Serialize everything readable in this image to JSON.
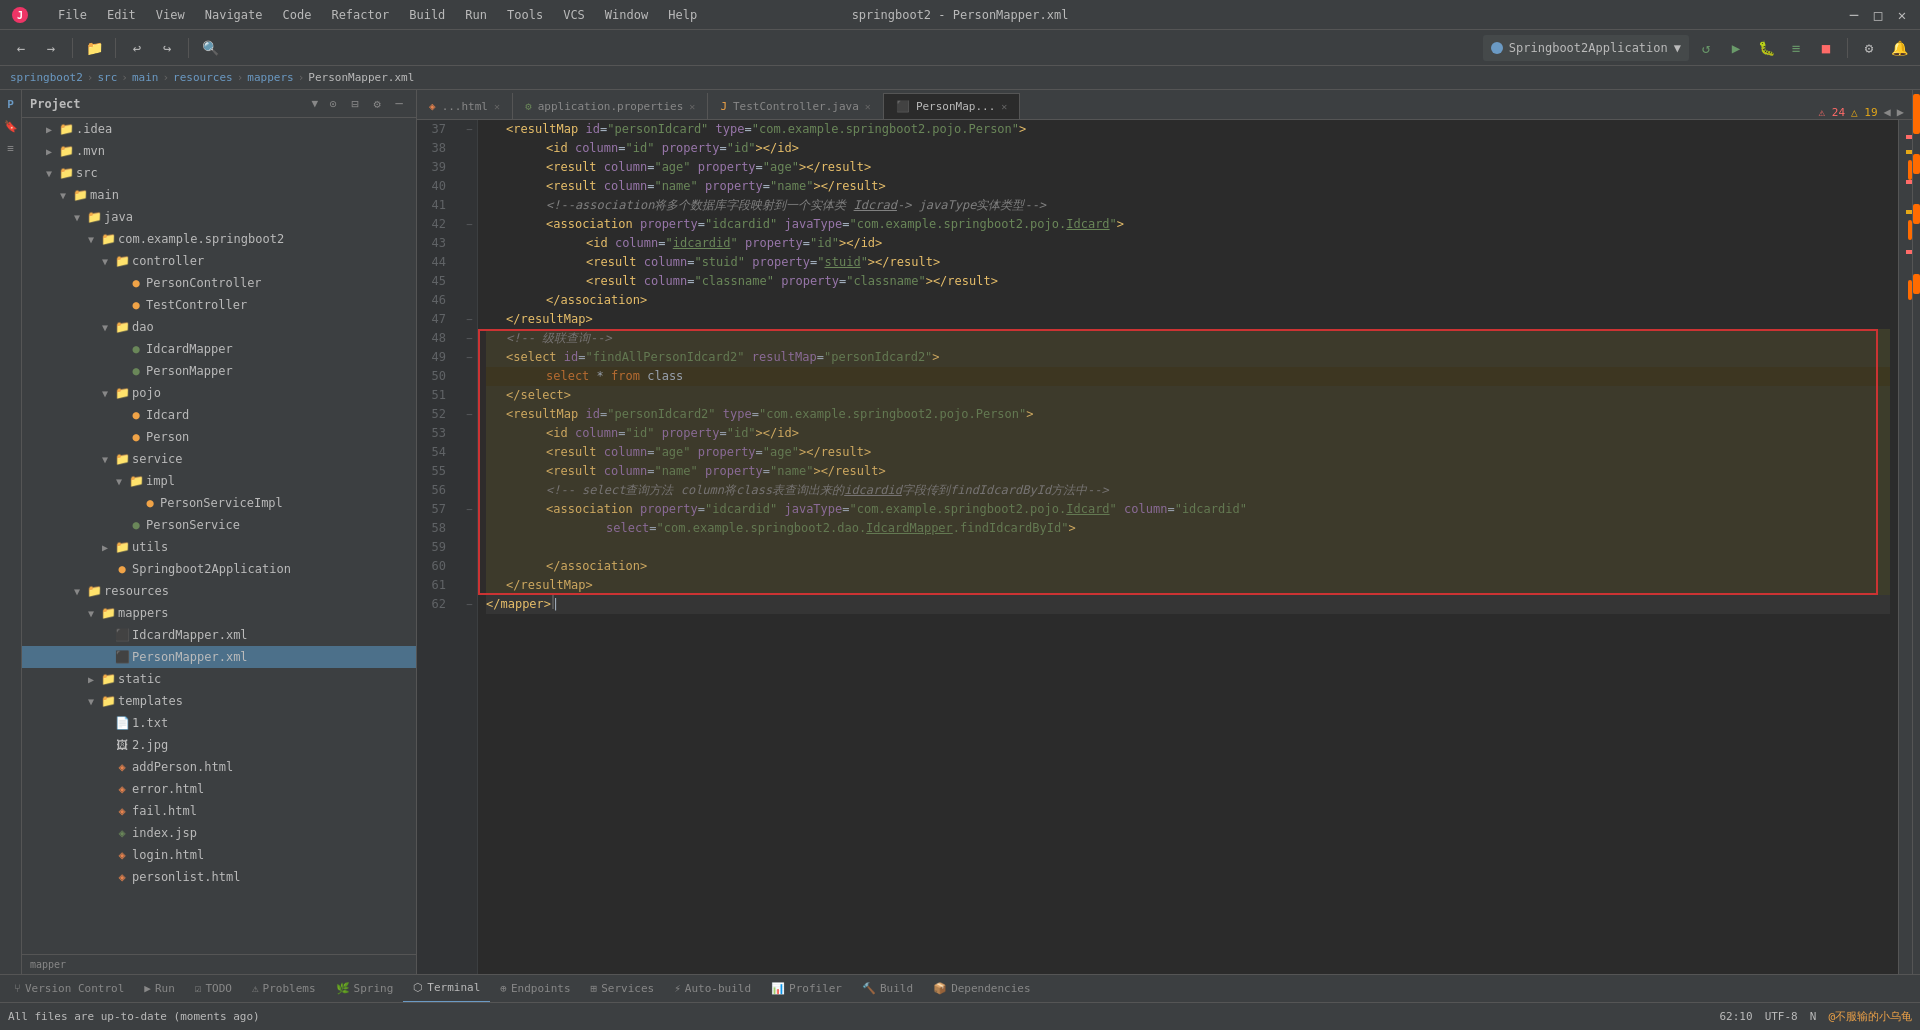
{
  "titleBar": {
    "title": "springboot2 - PersonMapper.xml",
    "menuItems": [
      "File",
      "Edit",
      "View",
      "Navigate",
      "Code",
      "Refactor",
      "Build",
      "Run",
      "Tools",
      "VCS",
      "Window",
      "Help"
    ]
  },
  "breadcrumb": {
    "items": [
      "springboot2",
      "src",
      "main",
      "resources",
      "mappers",
      "PersonMapper.xml"
    ]
  },
  "toolbar": {
    "runConfig": "Springboot2Application"
  },
  "projectPanel": {
    "title": "Project",
    "tree": [
      {
        "id": "idea",
        "label": ".idea",
        "indent": 1,
        "type": "folder",
        "open": false
      },
      {
        "id": "mvn",
        "label": ".mvn",
        "indent": 1,
        "type": "folder",
        "open": false
      },
      {
        "id": "src",
        "label": "src",
        "indent": 1,
        "type": "folder",
        "open": true
      },
      {
        "id": "main",
        "label": "main",
        "indent": 2,
        "type": "folder",
        "open": true
      },
      {
        "id": "java",
        "label": "java",
        "indent": 3,
        "type": "folder",
        "open": true
      },
      {
        "id": "com",
        "label": "com.example.springboot2",
        "indent": 4,
        "type": "folder",
        "open": true
      },
      {
        "id": "controller",
        "label": "controller",
        "indent": 5,
        "type": "folder",
        "open": true
      },
      {
        "id": "PersonController",
        "label": "PersonController",
        "indent": 6,
        "type": "java-c"
      },
      {
        "id": "TestController",
        "label": "TestController",
        "indent": 6,
        "type": "java-c"
      },
      {
        "id": "dao",
        "label": "dao",
        "indent": 5,
        "type": "folder",
        "open": true
      },
      {
        "id": "IdcardMapper",
        "label": "IdcardMapper",
        "indent": 6,
        "type": "java-i"
      },
      {
        "id": "PersonMapper",
        "label": "PersonMapper",
        "indent": 6,
        "type": "java-i"
      },
      {
        "id": "pojo",
        "label": "pojo",
        "indent": 5,
        "type": "folder",
        "open": true
      },
      {
        "id": "Idcard",
        "label": "Idcard",
        "indent": 6,
        "type": "java-c"
      },
      {
        "id": "Person",
        "label": "Person",
        "indent": 6,
        "type": "java-c"
      },
      {
        "id": "service",
        "label": "service",
        "indent": 5,
        "type": "folder",
        "open": true
      },
      {
        "id": "impl",
        "label": "impl",
        "indent": 6,
        "type": "folder",
        "open": true
      },
      {
        "id": "PersonServiceImpl",
        "label": "PersonServiceImpl",
        "indent": 7,
        "type": "java-c"
      },
      {
        "id": "PersonService",
        "label": "PersonService",
        "indent": 6,
        "type": "java-i"
      },
      {
        "id": "utils",
        "label": "utils",
        "indent": 5,
        "type": "folder",
        "open": false
      },
      {
        "id": "Springboot2App",
        "label": "Springboot2Application",
        "indent": 5,
        "type": "java-c"
      },
      {
        "id": "resources",
        "label": "resources",
        "indent": 3,
        "type": "folder",
        "open": true
      },
      {
        "id": "mappers",
        "label": "mappers",
        "indent": 4,
        "type": "folder",
        "open": true
      },
      {
        "id": "IdcardMapper.xml",
        "label": "IdcardMapper.xml",
        "indent": 5,
        "type": "xml"
      },
      {
        "id": "PersonMapper.xml",
        "label": "PersonMapper.xml",
        "indent": 5,
        "type": "xml",
        "selected": true
      },
      {
        "id": "static",
        "label": "static",
        "indent": 4,
        "type": "folder",
        "open": false
      },
      {
        "id": "templates",
        "label": "templates",
        "indent": 4,
        "type": "folder",
        "open": true
      },
      {
        "id": "1txt",
        "label": "1.txt",
        "indent": 5,
        "type": "txt"
      },
      {
        "id": "2jpg",
        "label": "2.jpg",
        "indent": 5,
        "type": "img"
      },
      {
        "id": "addPerson.html",
        "label": "addPerson.html",
        "indent": 5,
        "type": "html"
      },
      {
        "id": "error.html",
        "label": "error.html",
        "indent": 5,
        "type": "html"
      },
      {
        "id": "fail.html",
        "label": "fail.html",
        "indent": 5,
        "type": "html"
      },
      {
        "id": "index.jsp",
        "label": "index.jsp",
        "indent": 5,
        "type": "jsp"
      },
      {
        "id": "login.html",
        "label": "login.html",
        "indent": 5,
        "type": "html"
      },
      {
        "id": "personlist.html",
        "label": "personlist.html",
        "indent": 5,
        "type": "html"
      }
    ]
  },
  "tabs": [
    {
      "id": "t1",
      "label": "...html",
      "active": false,
      "icon": "html"
    },
    {
      "id": "t2",
      "label": "application.properties",
      "active": false,
      "icon": "prop"
    },
    {
      "id": "t3",
      "label": "TestController.java",
      "active": false,
      "icon": "java"
    },
    {
      "id": "t4",
      "label": "PersonMap...",
      "active": true,
      "icon": "xml"
    }
  ],
  "editorInfo": {
    "errors": "24",
    "warnings": "19"
  },
  "codeLines": [
    {
      "num": 37,
      "content": "resultmap_start"
    },
    {
      "num": 38,
      "content": "id_col"
    },
    {
      "num": 39,
      "content": "result_age"
    },
    {
      "num": 40,
      "content": "result_name"
    },
    {
      "num": 41,
      "content": "comment_association"
    },
    {
      "num": 42,
      "content": "assoc_start"
    },
    {
      "num": 43,
      "content": "assoc_id"
    },
    {
      "num": 44,
      "content": "assoc_stuid"
    },
    {
      "num": 45,
      "content": "assoc_classname"
    },
    {
      "num": 46,
      "content": "assoc_end"
    },
    {
      "num": 47,
      "content": "resultmap_end"
    },
    {
      "num": 48,
      "content": "comment_level"
    },
    {
      "num": 49,
      "content": "select_start"
    },
    {
      "num": 50,
      "content": "select_sql"
    },
    {
      "num": 51,
      "content": "select_end"
    },
    {
      "num": 52,
      "content": "resultmap2_start"
    },
    {
      "num": 53,
      "content": "id2_col"
    },
    {
      "num": 54,
      "content": "result_age2"
    },
    {
      "num": 55,
      "content": "result_name2"
    },
    {
      "num": 56,
      "content": "comment_select"
    },
    {
      "num": 57,
      "content": "assoc2_start"
    },
    {
      "num": 58,
      "content": "assoc2_select"
    },
    {
      "num": 59,
      "content": "empty"
    },
    {
      "num": 60,
      "content": "assoc2_end"
    },
    {
      "num": 61,
      "content": "resultmap2_end"
    },
    {
      "num": 62,
      "content": "mapper_end"
    }
  ],
  "footerPath": "mapper",
  "statusBar": {
    "versionControl": "Version Control",
    "run": "Run",
    "todo": "TODO",
    "problems": "Problems",
    "spring": "Spring",
    "terminal": "Terminal",
    "endpoints": "Endpoints",
    "services": "Services",
    "autoBuild": "Auto-build",
    "profiler": "Profiler",
    "build": "Build",
    "dependencies": "Dependencies",
    "coords": "62:10",
    "encoding": "UTF-8",
    "lineEnding": "N",
    "statusMsg": "All files are up-to-date (moments ago)"
  }
}
